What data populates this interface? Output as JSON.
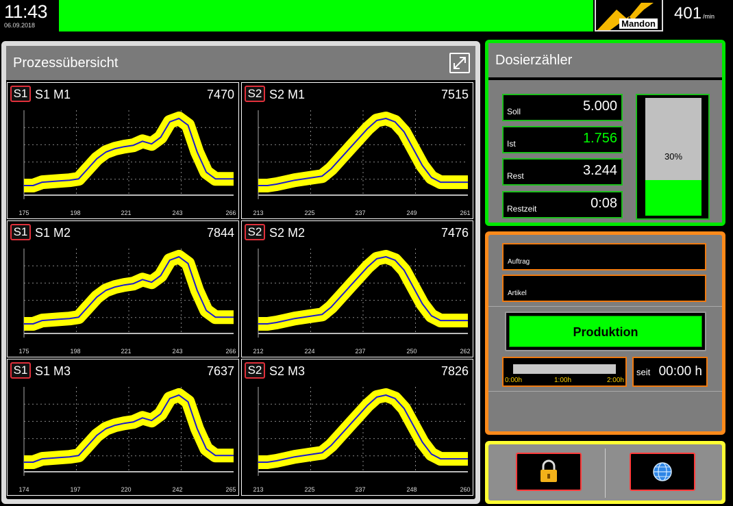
{
  "header": {
    "time": "11:43",
    "date": "06.09.2018",
    "status_color": "#00ff00",
    "logo_text": "Mandon",
    "speed_value": "401",
    "speed_unit": "/min"
  },
  "process_overview": {
    "title": "Prozessübersicht",
    "expand_icon": "expand-icon",
    "cells": [
      {
        "badge": "S1",
        "title": "S1 M1",
        "value": "7470",
        "x_ticks": [
          "175",
          "198",
          "221",
          "243",
          "266"
        ]
      },
      {
        "badge": "S2",
        "title": "S2 M1",
        "value": "7515",
        "x_ticks": [
          "213",
          "225",
          "237",
          "249",
          "261"
        ]
      },
      {
        "badge": "S1",
        "title": "S1 M2",
        "value": "7844",
        "x_ticks": [
          "175",
          "198",
          "221",
          "243",
          "266"
        ]
      },
      {
        "badge": "S2",
        "title": "S2 M2",
        "value": "7476",
        "x_ticks": [
          "212",
          "224",
          "237",
          "250",
          "262"
        ]
      },
      {
        "badge": "S1",
        "title": "S1 M3",
        "value": "7637",
        "x_ticks": [
          "174",
          "197",
          "220",
          "242",
          "265"
        ]
      },
      {
        "badge": "S2",
        "title": "S2 M3",
        "value": "7826",
        "x_ticks": [
          "213",
          "225",
          "237",
          "248",
          "260"
        ]
      }
    ]
  },
  "dosing_counter": {
    "title": "Dosierzähler",
    "fields": [
      {
        "label": "Soll",
        "value": "5.000"
      },
      {
        "label": "Ist",
        "value": "1.756"
      },
      {
        "label": "Rest",
        "value": "3.244"
      },
      {
        "label": "Restzeit",
        "value": "0:08"
      }
    ],
    "progress_label": "30%",
    "progress_fraction": 0.3
  },
  "production": {
    "order_label": "Auftrag",
    "article_label": "Artikel",
    "status_button": "Produktion",
    "time_ticks": [
      "0:00h",
      "1:00h",
      "2:00h"
    ],
    "since_label": "seit",
    "since_value": "00:00 h"
  },
  "buttons": {
    "lock_icon": "lock-icon",
    "language_icon": "globe-icon"
  }
}
